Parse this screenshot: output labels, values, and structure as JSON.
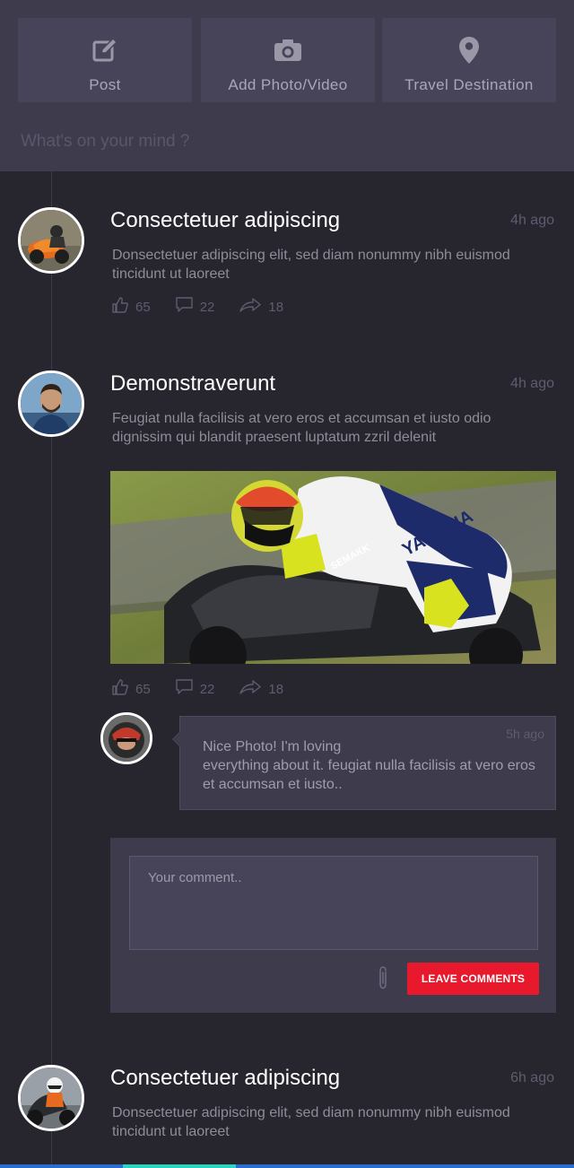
{
  "composer": {
    "actions": [
      {
        "label": "Post",
        "icon": "edit-icon"
      },
      {
        "label": "Add Photo/Video",
        "icon": "camera-icon"
      },
      {
        "label": "Travel Destination",
        "icon": "location-pin-icon"
      }
    ],
    "placeholder": "What's on your mind ?"
  },
  "posts": [
    {
      "title": "Consectetuer adipiscing",
      "time": "4h ago",
      "body": "Donsectetuer adipiscing elit, sed diam nonummy nibh euismod tincidunt ut  laoreet",
      "likes": "65",
      "comments": "22",
      "shares": "18"
    },
    {
      "title": "Demonstraverunt",
      "time": "4h ago",
      "body": "Feugiat nulla facilisis at vero eros et accumsan et iusto odio dignissim qui blandit praesent luptatum zzril delenit",
      "likes": "65",
      "comments": "22",
      "shares": "18",
      "comment": {
        "time": "5h ago",
        "text_line1": "Nice Photo! I'm loving",
        "text_line2": "everything about it. feugiat nulla facilisis at vero eros et accumsan et iusto.."
      },
      "reply": {
        "placeholder": "Your comment..",
        "button_label": "LEAVE COMMENTS"
      }
    },
    {
      "title": "Consectetuer adipiscing",
      "time": "6h ago",
      "body": "Donsectetuer adipiscing elit, sed diam nonummy nibh euismod tincidunt ut  laoreet"
    }
  ],
  "colors": {
    "background": "#27262f",
    "panel": "#3e3b4d",
    "button": "#47445a",
    "accent": "#e8192c"
  }
}
